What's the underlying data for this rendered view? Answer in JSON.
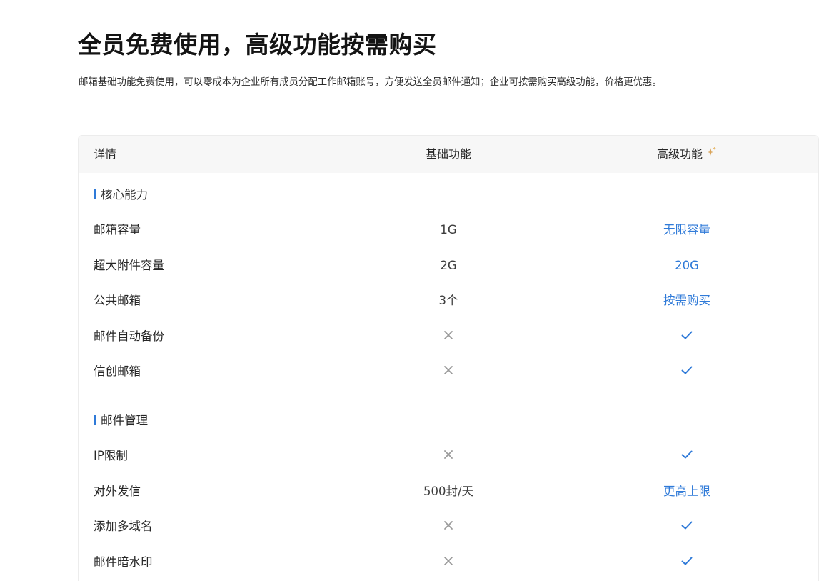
{
  "hero": {
    "title": "全员免费使用，高级功能按需购买",
    "subtitle": "邮箱基础功能免费使用，可以零成本为企业所有成员分配工作邮箱账号，方便发送全员邮件通知；企业可按需购买高级功能，价格更优惠。"
  },
  "table": {
    "headers": {
      "detail": "详情",
      "basic": "基础功能",
      "advanced": "高级功能",
      "advanced_icon": "sparkle-icon"
    },
    "sections": [
      {
        "title": "核心能力",
        "rows": [
          {
            "name": "邮箱容量",
            "basic": "1G",
            "advanced": "无限容量"
          },
          {
            "name": "超大附件容量",
            "basic": "2G",
            "advanced": "20G"
          },
          {
            "name": "公共邮箱",
            "basic": "3个",
            "advanced": "按需购买"
          },
          {
            "name": "邮件自动备份",
            "basic_icon": "cross-icon",
            "advanced_icon": "check-icon"
          },
          {
            "name": "信创邮箱",
            "basic_icon": "cross-icon",
            "advanced_icon": "check-icon"
          }
        ]
      },
      {
        "title": "邮件管理",
        "rows": [
          {
            "name": "IP限制",
            "basic_icon": "cross-icon",
            "advanced_icon": "check-icon"
          },
          {
            "name": "对外发信",
            "basic": "500封/天",
            "advanced": "更高上限"
          },
          {
            "name": "添加多域名",
            "basic_icon": "cross-icon",
            "advanced_icon": "check-icon"
          },
          {
            "name": "邮件暗水印",
            "basic_icon": "cross-icon",
            "advanced_icon": "check-icon"
          }
        ]
      }
    ]
  },
  "colors": {
    "accent": "#2f7ad8",
    "cross": "#9a9a9a",
    "sparkle": "#d9a45a",
    "header_bg": "#f7f7f7"
  }
}
